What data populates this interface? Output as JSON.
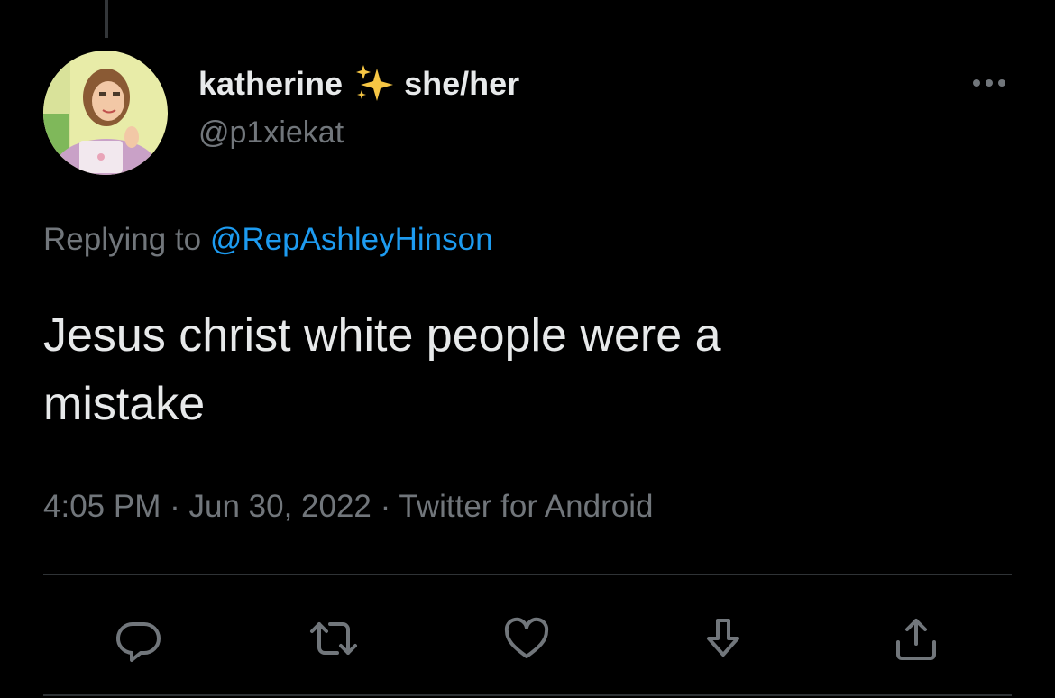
{
  "tweet": {
    "display_name": "katherine",
    "name_emoji": "sparkles-emoji",
    "pronouns": "she/her",
    "handle": "@p1xiekat",
    "replying_prefix": "Replying to",
    "replying_to": "@RepAshleyHinson",
    "text_line1": "Jesus christ white people were a",
    "text_line2": "mistake",
    "time": "4:05 PM",
    "separator": "·",
    "date": "Jun 30, 2022",
    "source": "Twitter for Android"
  },
  "icons": {
    "more": "more-horizontal-icon",
    "reply": "reply-icon",
    "retweet": "retweet-icon",
    "like": "like-icon",
    "bookmark": "download-arrow-icon",
    "share": "share-icon"
  },
  "colors": {
    "background": "#000000",
    "primary_text": "#e7e9ea",
    "secondary_text": "#71767b",
    "link": "#1d9bf0",
    "divider": "#2f3336",
    "sparkle": "#f6c644"
  }
}
